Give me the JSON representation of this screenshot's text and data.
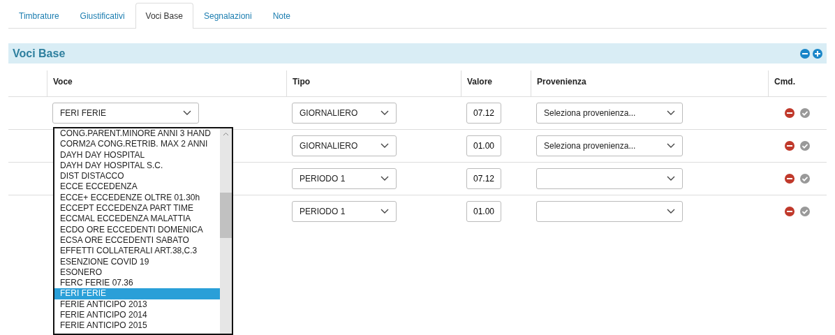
{
  "tabs": [
    {
      "label": "Timbrature",
      "selected": false
    },
    {
      "label": "Giustificativi",
      "selected": false
    },
    {
      "label": "Voci Base",
      "selected": true
    },
    {
      "label": "Segnalazioni",
      "selected": false
    },
    {
      "label": "Note",
      "selected": false
    }
  ],
  "section": {
    "title": "Voci Base"
  },
  "table": {
    "columns": [
      "Voce",
      "Tipo",
      "Valore",
      "Provenienza",
      "Cmd."
    ],
    "rows": [
      {
        "voce": "FERI FERIE",
        "tipo": "GIORNALIERO",
        "valore": "07.12",
        "provenienza": "Seleziona provenienza..."
      },
      {
        "tipo": "GIORNALIERO",
        "valore": "01.00",
        "provenienza": "Seleziona provenienza..."
      },
      {
        "tipo": "PERIODO 1",
        "valore": "07.12"
      },
      {
        "tipo": "PERIODO 1",
        "valore": "01.00"
      }
    ]
  },
  "dropdown": {
    "options": [
      {
        "label": "CONG.PARENT.MINORE ANNI 3 HAND",
        "selected": false
      },
      {
        "label": "CORM2A CONG.RETRIB. MAX 2 ANNI",
        "selected": false
      },
      {
        "label": "DAYH DAY HOSPITAL",
        "selected": false
      },
      {
        "label": "DAYH DAY HOSPITAL S.C.",
        "selected": false
      },
      {
        "label": "DIST DISTACCO",
        "selected": false
      },
      {
        "label": "ECCE ECCEDENZA",
        "selected": false
      },
      {
        "label": "ECCE+ ECCEDENZE OLTRE 01.30h",
        "selected": false
      },
      {
        "label": "ECCEPT ECCEDENZA PART TIME",
        "selected": false
      },
      {
        "label": "ECCMAL ECCEDENZA MALATTIA",
        "selected": false
      },
      {
        "label": "ECDO ORE ECCEDENTI DOMENICA",
        "selected": false
      },
      {
        "label": "ECSA ORE ECCEDENTI SABATO",
        "selected": false
      },
      {
        "label": "EFFETTI COLLATERALI ART.38,C.3",
        "selected": false
      },
      {
        "label": "ESENZIONE COVID 19",
        "selected": false
      },
      {
        "label": "ESONERO",
        "selected": false
      },
      {
        "label": "FERC FERIE 07.36",
        "selected": false
      },
      {
        "label": "FERI FERIE",
        "selected": true
      },
      {
        "label": "FERIE ANTICIPO 2013",
        "selected": false
      },
      {
        "label": "FERIE ANTICIPO 2014",
        "selected": false
      },
      {
        "label": "FERIE ANTICIPO 2015",
        "selected": false
      }
    ]
  }
}
